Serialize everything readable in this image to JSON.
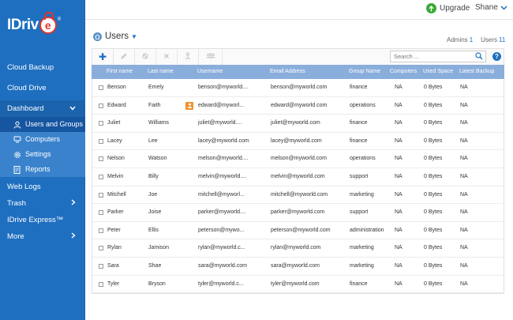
{
  "brand": {
    "logo_text": "IDriv",
    "logo_e": "e",
    "registered": "®"
  },
  "sidebar": {
    "items": [
      {
        "label": "Cloud Backup"
      },
      {
        "label": "Cloud Drive"
      },
      {
        "label": "Dashboard",
        "expanded": true
      },
      {
        "label": "Web Logs"
      },
      {
        "label": "Trash"
      },
      {
        "label": "IDrive Express™"
      },
      {
        "label": "More"
      }
    ],
    "dashboard_children": [
      {
        "label": "Users and Groups",
        "icon": "user-icon",
        "active": true
      },
      {
        "label": "Computers",
        "icon": "computer-icon"
      },
      {
        "label": "Settings",
        "icon": "gear-icon"
      },
      {
        "label": "Reports",
        "icon": "report-icon"
      }
    ]
  },
  "header": {
    "upgrade_label": "Upgrade",
    "user_name": "Shane"
  },
  "page": {
    "title": "Users",
    "admins_label": "Admins",
    "admins_count": "1",
    "users_label": "Users",
    "users_count": "11"
  },
  "toolbar": {
    "search_placeholder": "Search ...",
    "buttons": [
      "add-icon",
      "edit-icon",
      "disable-icon",
      "delete-icon",
      "assign-icon",
      "group-icon"
    ]
  },
  "table": {
    "columns": [
      "First name",
      "Last name",
      "Username",
      "Email Address",
      "Group Name",
      "Computers",
      "Used Space",
      "Latest Backup"
    ],
    "rows": [
      {
        "first": "Benson",
        "last": "Emely",
        "username": "benson@myworld....",
        "email": "benson@myworld.com",
        "group": "finance",
        "computers": "NA",
        "used": "0 Bytes",
        "latest": "NA",
        "admin": false
      },
      {
        "first": "Edward",
        "last": "Faith",
        "username": "edward@myworl...",
        "email": "edward@myworld.com",
        "group": "operations",
        "computers": "NA",
        "used": "0 Bytes",
        "latest": "NA",
        "admin": true
      },
      {
        "first": "Juliet",
        "last": "Williams",
        "username": "juliet@myworld....",
        "email": "juliet@myworld.com",
        "group": "finance",
        "computers": "NA",
        "used": "0 Bytes",
        "latest": "NA",
        "admin": false
      },
      {
        "first": "Lacey",
        "last": "Lee",
        "username": "lacey@myworld.com",
        "email": "lacey@myworld.com",
        "group": "finance",
        "computers": "NA",
        "used": "0 Bytes",
        "latest": "NA",
        "admin": false
      },
      {
        "first": "Nelson",
        "last": "Watson",
        "username": "melson@myworld....",
        "email": "melson@myworld.com",
        "group": "operations",
        "computers": "NA",
        "used": "0 Bytes",
        "latest": "NA",
        "admin": false
      },
      {
        "first": "Melvin",
        "last": "Billy",
        "username": "melvin@myworld....",
        "email": "melvin@myworld.com",
        "group": "support",
        "computers": "NA",
        "used": "0 Bytes",
        "latest": "NA",
        "admin": false
      },
      {
        "first": "Mitchell",
        "last": "Joe",
        "username": "mitchell@myworl...",
        "email": "mitchell@myworld.com",
        "group": "marketing",
        "computers": "NA",
        "used": "0 Bytes",
        "latest": "NA",
        "admin": false
      },
      {
        "first": "Parker",
        "last": "Joise",
        "username": "parker@myworld....",
        "email": "parker@myworld.com",
        "group": "support",
        "computers": "NA",
        "used": "0 Bytes",
        "latest": "NA",
        "admin": false
      },
      {
        "first": "Peter",
        "last": "Ellis",
        "username": "peterson@mywo...",
        "email": "peterson@myworld.com",
        "group": "administration",
        "computers": "NA",
        "used": "0 Bytes",
        "latest": "NA",
        "admin": false
      },
      {
        "first": "Rylan",
        "last": "Jamison",
        "username": "rylan@myworld.c...",
        "email": "rylan@myworld.com",
        "group": "marketing",
        "computers": "NA",
        "used": "0 Bytes",
        "latest": "NA",
        "admin": false
      },
      {
        "first": "Sara",
        "last": "Shae",
        "username": "sara@myworld.com",
        "email": "sara@myworld.com",
        "group": "marketing",
        "computers": "NA",
        "used": "0 Bytes",
        "latest": "NA",
        "admin": false
      },
      {
        "first": "Tyler",
        "last": "Bryson",
        "username": "tyler@myworld.c...",
        "email": "tyler@myworld.com",
        "group": "finance",
        "computers": "NA",
        "used": "0 Bytes",
        "latest": "NA",
        "admin": false
      }
    ]
  },
  "colors": {
    "sidebar_bg": "#1e6fc0",
    "sidebar_sub_bg": "#3a83cc",
    "sidebar_active": "#1655a0",
    "table_header_bg": "#8aaedb",
    "accent": "#1e6fc0",
    "logo_red": "#e0362c",
    "upgrade_green": "#3aaa35",
    "admin_badge": "#f0932f"
  }
}
